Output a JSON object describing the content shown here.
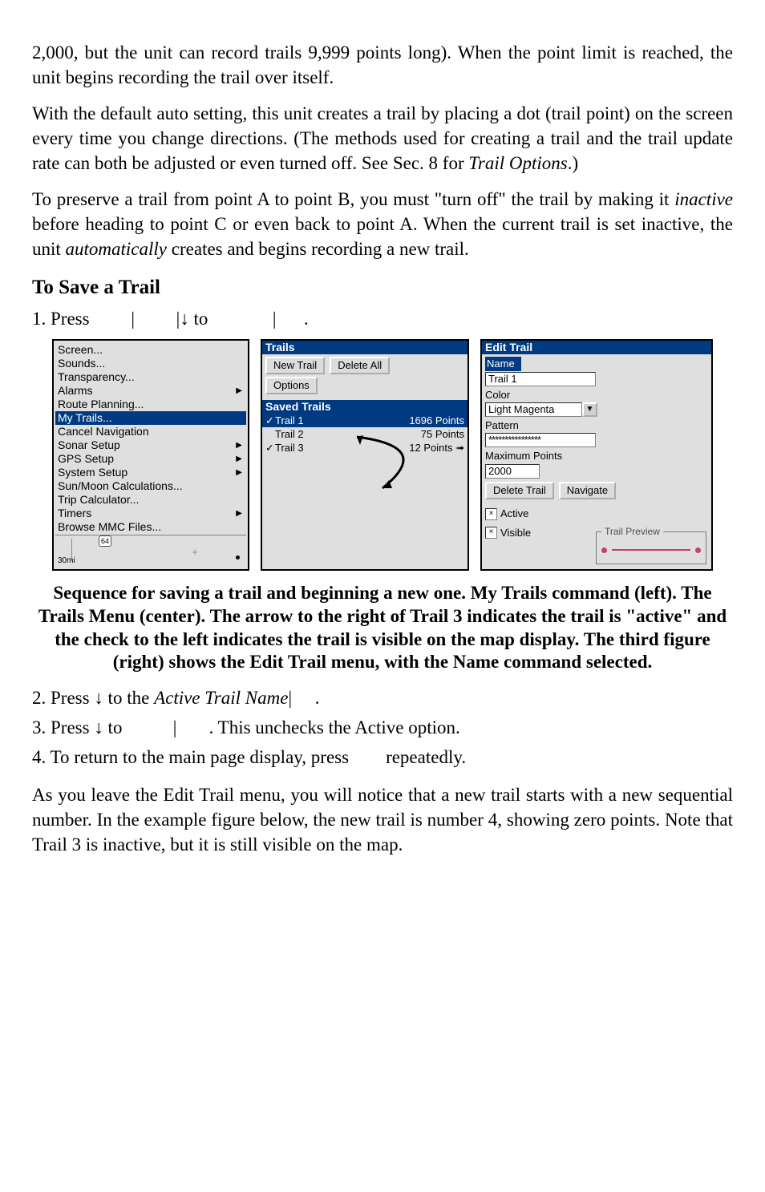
{
  "para1": "2,000, but the unit can record trails 9,999 points long). When the point limit is reached, the unit begins recording the trail over itself.",
  "para2_a": "With the default auto setting, this unit creates a trail by placing a dot (trail point) on the screen every time you change directions. (The methods used for creating a trail and the trail update rate can both be adjusted or even turned off. See Sec. 8 for ",
  "para2_i": "Trail Options",
  "para2_b": ".)",
  "para3_a": "To preserve a trail from point A to point B, you must \"turn off\" the trail by making it ",
  "para3_i1": "inactive",
  "para3_b": " before heading to point C or even back to point A. When the current trail is set inactive, the unit ",
  "para3_i2": "automatically",
  "para3_c": " creates and begins recording a new trail.",
  "section": "To Save a Trail",
  "step1_a": "1. Press ",
  "step1_b": "|",
  "step1_c": "|↓ to ",
  "step1_d": "|",
  "step1_e": ".",
  "menu_items": [
    {
      "label": "Screen...",
      "submenu": false,
      "selected": false
    },
    {
      "label": "Sounds...",
      "submenu": false,
      "selected": false
    },
    {
      "label": "Transparency...",
      "submenu": false,
      "selected": false
    },
    {
      "label": "Alarms",
      "submenu": true,
      "selected": false
    },
    {
      "label": "Route Planning...",
      "submenu": false,
      "selected": false
    },
    {
      "label": "My Trails...",
      "submenu": false,
      "selected": true
    },
    {
      "label": "Cancel Navigation",
      "submenu": false,
      "selected": false
    },
    {
      "label": "Sonar Setup",
      "submenu": true,
      "selected": false
    },
    {
      "label": "GPS Setup",
      "submenu": true,
      "selected": false
    },
    {
      "label": "System Setup",
      "submenu": true,
      "selected": false
    },
    {
      "label": "Sun/Moon Calculations...",
      "submenu": false,
      "selected": false
    },
    {
      "label": "Trip Calculator...",
      "submenu": false,
      "selected": false
    },
    {
      "label": "Timers",
      "submenu": true,
      "selected": false
    },
    {
      "label": "Browse MMC Files...",
      "submenu": false,
      "selected": false
    }
  ],
  "map_scale": "30mi",
  "map_hwy": "64",
  "trails_header": "Trails",
  "btn_new_trail": "New Trail",
  "btn_delete_all": "Delete All",
  "btn_options": "Options",
  "saved_trails_label": "Saved Trails",
  "trails": [
    {
      "name": "Trail 1",
      "points": "1696 Points",
      "checked": true,
      "selected": true
    },
    {
      "name": "Trail 2",
      "points": "75 Points",
      "checked": false,
      "selected": false
    },
    {
      "name": "Trail 3",
      "points": "12 Points",
      "checked": true,
      "selected": false
    }
  ],
  "edit_trail_header": "Edit Trail",
  "lbl_name": "Name",
  "val_name": "Trail 1",
  "lbl_color": "Color",
  "val_color": "Light Magenta",
  "lbl_pattern": "Pattern",
  "val_pattern": "****************",
  "lbl_maxpts": "Maximum Points",
  "val_maxpts": "2000",
  "btn_delete_trail": "Delete Trail",
  "btn_navigate": "Navigate",
  "chk_active": "Active",
  "chk_visible": "Visible",
  "legend_preview": "Trail Preview",
  "caption": "Sequence for saving a trail and beginning a new one. My Trails command (left). The Trails Menu (center). The arrow to the right of Trail 3 indicates the trail is \"active\" and the check to the left indicates the trail is visible on the map display. The third figure (right) shows the Edit Trail menu, with the Name command selected.",
  "step2_a": "2. Press ↓ to the ",
  "step2_i": "Active Trail Name",
  "step2_b": "|",
  "step2_c": ".",
  "step3_a": "3. Press ↓ to ",
  "step3_b": "|",
  "step3_c": ". This unchecks the Active option.",
  "step4_a": "4. To return to the main page display, press ",
  "step4_b": "repeatedly.",
  "para4": "As you leave the Edit Trail menu, you will notice that a new trail starts with a new sequential number. In the example figure below, the new trail is number 4, showing zero points. Note that Trail 3 is inactive, but it is still visible on the map."
}
